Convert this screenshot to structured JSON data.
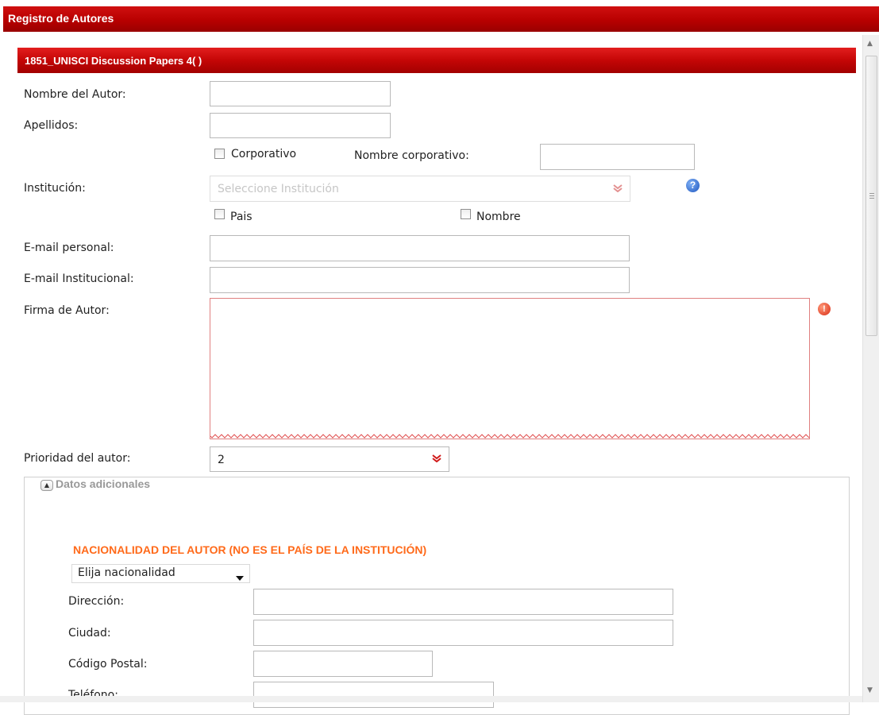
{
  "window": {
    "title": "Registro de Autores"
  },
  "panel": {
    "title": "1851_UNISCI Discussion Papers 4( )"
  },
  "form": {
    "nombre_label": "Nombre del Autor:",
    "apellidos_label": "Apellidos:",
    "corporativo_label": "Corporativo",
    "nombre_corporativo_label": "Nombre corporativo:",
    "institucion_label": "Institución:",
    "institucion_placeholder": "Seleccione Institución",
    "pais_label": "Pais",
    "nombre_label_chk": "Nombre",
    "email_personal_label": "E-mail personal:",
    "email_institucional_label": "E-mail Institucional:",
    "firma_label": "Firma de Autor:",
    "prioridad_label": "Prioridad del autor:",
    "prioridad_value": "2"
  },
  "datos_adicionales": {
    "legend": "Datos adicionales",
    "nacionalidad_heading": "NACIONALIDAD DEL AUTOR (NO ES EL PAÍS DE LA INSTITUCIÓN)",
    "nacionalidad_value": "Elija nacionalidad",
    "direccion_label": "Dirección:",
    "ciudad_label": "Ciudad:",
    "codigo_postal_label": "Código Postal:",
    "telefono_label": "Teléfono:"
  },
  "icons": {
    "help": "help-icon",
    "error": "error-icon"
  },
  "colors": {
    "header_red": "#c40606",
    "accent_orange": "#ff6a1a",
    "help_blue": "#2a62c8",
    "error_red": "#e03a1a"
  }
}
